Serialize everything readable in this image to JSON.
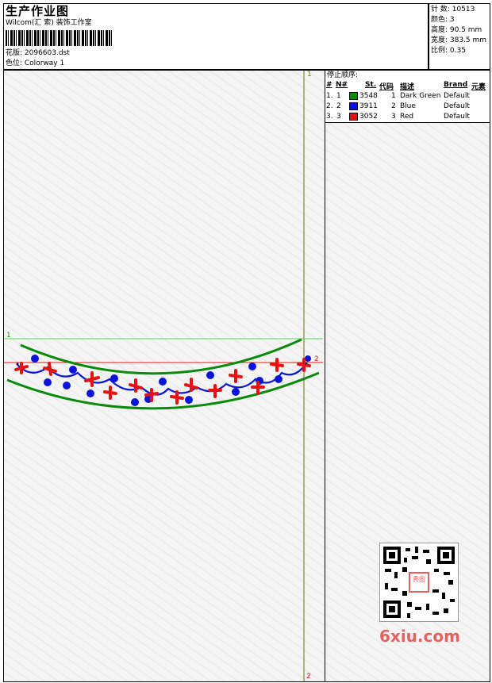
{
  "header": {
    "title": "生产作业图",
    "company": "Wilcom(汇 索) 装饰工作室",
    "design_label": "花版: 2096603.dst",
    "colorway_label": "色位: Colorway 1"
  },
  "stats": {
    "stitches": "针 数: 10513",
    "colors": "颜色: 3",
    "height": "高度: 90.5 mm",
    "width": "宽度: 383.5 mm",
    "scale": "比例: 0.35"
  },
  "stop_sequence": {
    "heading": "停止顺序:",
    "columns": [
      "#",
      "N#",
      "St.",
      "代码",
      "描述",
      "Brand",
      "元素"
    ],
    "rows": [
      {
        "num": "1.",
        "n": "1",
        "code": "3548",
        "st": "1",
        "desc": "Dark Green",
        "brand": "Default",
        "color": "#008a00"
      },
      {
        "num": "2.",
        "n": "2",
        "code": "3911",
        "st": "2",
        "desc": "Blue",
        "brand": "Default",
        "color": "#0a14d8"
      },
      {
        "num": "3.",
        "n": "3",
        "code": "3052",
        "st": "3",
        "desc": "Red",
        "brand": "Default",
        "color": "#e81010"
      }
    ]
  },
  "markers": {
    "top_v": "1",
    "bottom_v": "2",
    "left_h": "1",
    "right_h": "2"
  },
  "watermark": {
    "site": "6xiu.com",
    "qr_badge": "秀图"
  },
  "palette": {
    "green": "#0a8a0a",
    "blue": "#0a14d8",
    "red": "#e81010",
    "guide_green": "#5ad85a",
    "guide_red": "#d82020",
    "guide_olive": "#8a8a10"
  }
}
